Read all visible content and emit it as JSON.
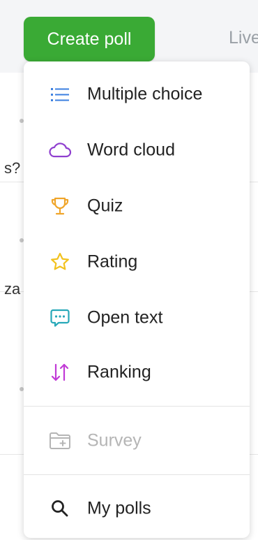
{
  "topbar": {
    "create_label": "Create poll",
    "live_tab_label": "Live"
  },
  "background": {
    "fragment_1": "s?",
    "fragment_2": "za"
  },
  "menu": {
    "items": [
      {
        "label": "Multiple choice",
        "icon": "list-icon",
        "color": "#3b7fe0"
      },
      {
        "label": "Word cloud",
        "icon": "cloud-icon",
        "color": "#8f3fcf"
      },
      {
        "label": "Quiz",
        "icon": "trophy-icon",
        "color": "#f0a52a"
      },
      {
        "label": "Rating",
        "icon": "star-icon",
        "color": "#f2c21f"
      },
      {
        "label": "Open text",
        "icon": "chat-bubble-icon",
        "color": "#27a8b8"
      },
      {
        "label": "Ranking",
        "icon": "sort-arrows-icon",
        "color": "#c13ad6"
      }
    ],
    "survey": {
      "label": "Survey",
      "icon": "folder-plus-icon",
      "color": "#b5b5b5"
    },
    "my_polls": {
      "label": "My polls",
      "icon": "search-icon",
      "color": "#222222"
    }
  },
  "colors": {
    "primary_green": "#3aaa35"
  }
}
